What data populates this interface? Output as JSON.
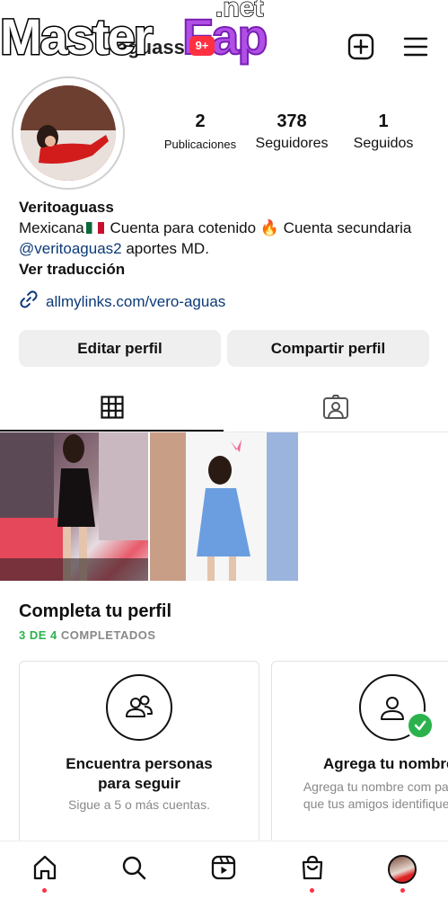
{
  "header": {
    "username_partial": "aguass",
    "watermark_master": "Master",
    "watermark_fap": "Fap",
    "watermark_net": ".net",
    "notification_badge": "9+"
  },
  "profile": {
    "stats": [
      {
        "value": "2",
        "label": "Publicaciones"
      },
      {
        "value": "378",
        "label": "Seguidores"
      },
      {
        "value": "1",
        "label": "Seguidos"
      }
    ],
    "name": "Veritoaguass",
    "bio_part1": "Mexicana",
    "bio_part2": " Cuenta para cotenido ",
    "bio_fire": "🔥",
    "bio_part3": " Cuenta secundaria ",
    "bio_mention": "@veritoaguas2",
    "bio_part4": " aportes MD.",
    "translate": "Ver traducción",
    "link": "allmylinks.com/vero-aguas"
  },
  "buttons": {
    "edit": "Editar perfil",
    "share": "Compartir perfil"
  },
  "complete": {
    "title": "Completa tu perfil",
    "progress_done": "3 DE 4",
    "progress_rest": " COMPLETADOS",
    "cards": [
      {
        "title": "Encuentra personas para seguir",
        "desc": "Sigue a 5 o más cuentas."
      },
      {
        "title": "Agrega tu nombre",
        "desc": "Agrega tu nombre com para que tus amigos identifiquen."
      }
    ]
  },
  "colors": {
    "accent_link": "#0b3a78",
    "success": "#2bb24c",
    "badge": "#ff3040"
  }
}
